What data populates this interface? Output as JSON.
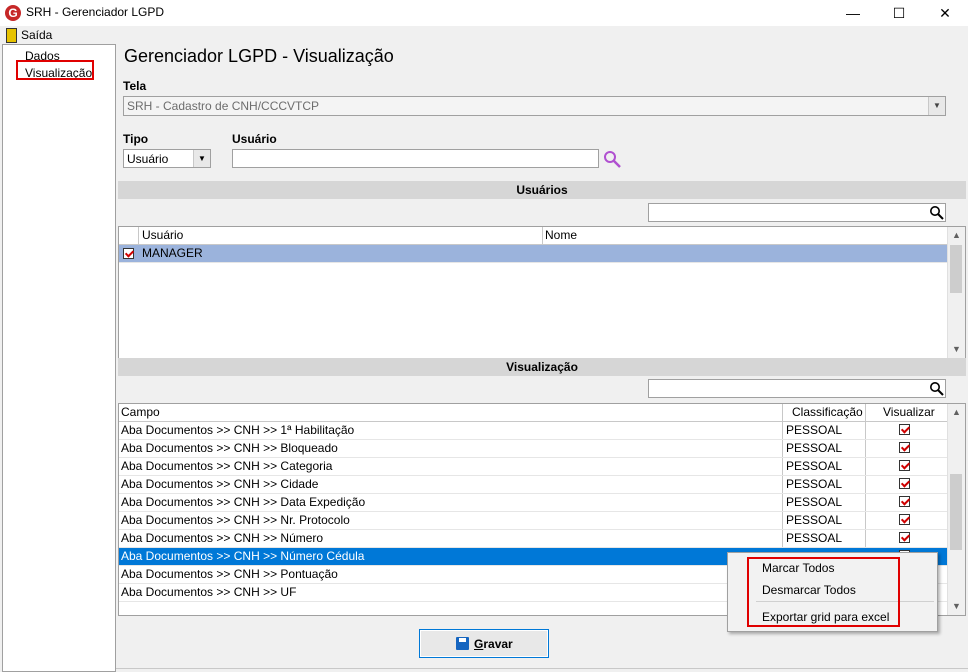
{
  "window": {
    "app_icon_letter": "G",
    "title": "SRH - Gerenciador LGPD",
    "minimize_glyph": "—",
    "maximize_glyph": "☐",
    "close_glyph": "✕"
  },
  "menu": {
    "exit_label": "Saída"
  },
  "tree": {
    "items": [
      "Dados",
      "Visualização"
    ],
    "selected": "Visualização"
  },
  "main": {
    "title": "Gerenciador LGPD - Visualização",
    "tela": {
      "label": "Tela",
      "value": "SRH - Cadastro de CNH/CCCVTCP"
    },
    "tipo": {
      "label": "Tipo",
      "value": "Usuário"
    },
    "usuario": {
      "label": "Usuário",
      "value": ""
    }
  },
  "users_section": {
    "title": "Usuários",
    "search_value": "",
    "columns": [
      "Usuário",
      "Nome"
    ],
    "rows": [
      {
        "checked": true,
        "usuario": "MANAGER",
        "nome": ""
      }
    ]
  },
  "view_section": {
    "title": "Visualização",
    "search_value": "",
    "columns": [
      "Campo",
      "Classificação",
      "Visualizar"
    ],
    "rows": [
      {
        "campo": "Aba Documentos >> CNH >> 1ª Habilitação",
        "classificacao": "PESSOAL",
        "visualizar": true
      },
      {
        "campo": "Aba Documentos >> CNH >> Bloqueado",
        "classificacao": "PESSOAL",
        "visualizar": true
      },
      {
        "campo": "Aba Documentos >> CNH >> Categoria",
        "classificacao": "PESSOAL",
        "visualizar": true
      },
      {
        "campo": "Aba Documentos >> CNH >> Cidade",
        "classificacao": "PESSOAL",
        "visualizar": true
      },
      {
        "campo": "Aba Documentos >> CNH >> Data Expedição",
        "classificacao": "PESSOAL",
        "visualizar": true
      },
      {
        "campo": "Aba Documentos >> CNH >> Nr. Protocolo",
        "classificacao": "PESSOAL",
        "visualizar": true
      },
      {
        "campo": "Aba Documentos >> CNH >> Número",
        "classificacao": "PESSOAL",
        "visualizar": true
      },
      {
        "campo": "Aba Documentos >> CNH >> Número Cédula",
        "classificacao": "",
        "visualizar": true,
        "selected": true
      },
      {
        "campo": "Aba Documentos >> CNH >> Pontuação",
        "classificacao": "",
        "visualizar": true
      },
      {
        "campo": "Aba Documentos >> CNH >> UF",
        "classificacao": "",
        "visualizar": true
      }
    ]
  },
  "context_menu": {
    "items": [
      "Marcar Todos",
      "Desmarcar Todos",
      "Exportar grid para excel"
    ]
  },
  "footer": {
    "save_label_underlined": "G",
    "save_label_rest": "ravar"
  },
  "colors": {
    "selection": "#0078d7",
    "highlight_box": "#e00000",
    "checkmark": "#d00000"
  }
}
